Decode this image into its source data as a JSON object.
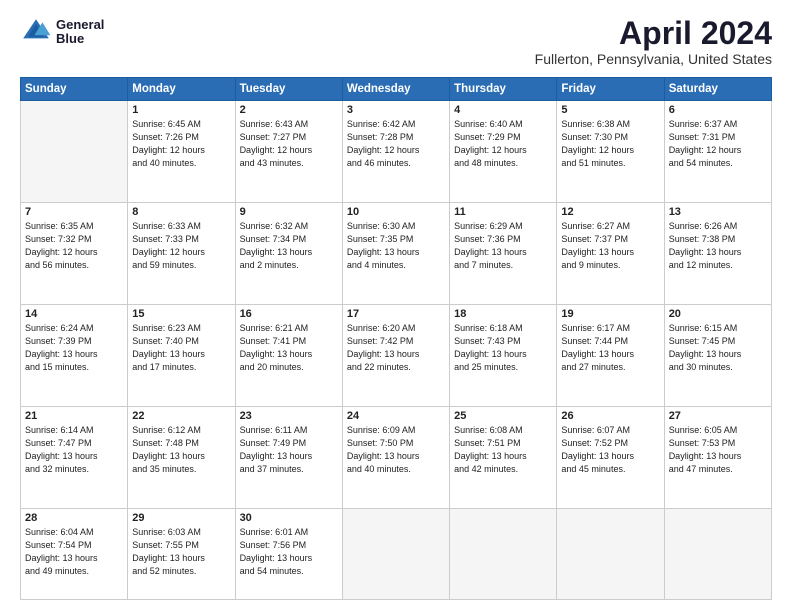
{
  "header": {
    "logo_line1": "General",
    "logo_line2": "Blue",
    "title": "April 2024",
    "subtitle": "Fullerton, Pennsylvania, United States"
  },
  "columns": [
    "Sunday",
    "Monday",
    "Tuesday",
    "Wednesday",
    "Thursday",
    "Friday",
    "Saturday"
  ],
  "weeks": [
    [
      {
        "day": "",
        "info": ""
      },
      {
        "day": "1",
        "info": "Sunrise: 6:45 AM\nSunset: 7:26 PM\nDaylight: 12 hours\nand 40 minutes."
      },
      {
        "day": "2",
        "info": "Sunrise: 6:43 AM\nSunset: 7:27 PM\nDaylight: 12 hours\nand 43 minutes."
      },
      {
        "day": "3",
        "info": "Sunrise: 6:42 AM\nSunset: 7:28 PM\nDaylight: 12 hours\nand 46 minutes."
      },
      {
        "day": "4",
        "info": "Sunrise: 6:40 AM\nSunset: 7:29 PM\nDaylight: 12 hours\nand 48 minutes."
      },
      {
        "day": "5",
        "info": "Sunrise: 6:38 AM\nSunset: 7:30 PM\nDaylight: 12 hours\nand 51 minutes."
      },
      {
        "day": "6",
        "info": "Sunrise: 6:37 AM\nSunset: 7:31 PM\nDaylight: 12 hours\nand 54 minutes."
      }
    ],
    [
      {
        "day": "7",
        "info": "Sunrise: 6:35 AM\nSunset: 7:32 PM\nDaylight: 12 hours\nand 56 minutes."
      },
      {
        "day": "8",
        "info": "Sunrise: 6:33 AM\nSunset: 7:33 PM\nDaylight: 12 hours\nand 59 minutes."
      },
      {
        "day": "9",
        "info": "Sunrise: 6:32 AM\nSunset: 7:34 PM\nDaylight: 13 hours\nand 2 minutes."
      },
      {
        "day": "10",
        "info": "Sunrise: 6:30 AM\nSunset: 7:35 PM\nDaylight: 13 hours\nand 4 minutes."
      },
      {
        "day": "11",
        "info": "Sunrise: 6:29 AM\nSunset: 7:36 PM\nDaylight: 13 hours\nand 7 minutes."
      },
      {
        "day": "12",
        "info": "Sunrise: 6:27 AM\nSunset: 7:37 PM\nDaylight: 13 hours\nand 9 minutes."
      },
      {
        "day": "13",
        "info": "Sunrise: 6:26 AM\nSunset: 7:38 PM\nDaylight: 13 hours\nand 12 minutes."
      }
    ],
    [
      {
        "day": "14",
        "info": "Sunrise: 6:24 AM\nSunset: 7:39 PM\nDaylight: 13 hours\nand 15 minutes."
      },
      {
        "day": "15",
        "info": "Sunrise: 6:23 AM\nSunset: 7:40 PM\nDaylight: 13 hours\nand 17 minutes."
      },
      {
        "day": "16",
        "info": "Sunrise: 6:21 AM\nSunset: 7:41 PM\nDaylight: 13 hours\nand 20 minutes."
      },
      {
        "day": "17",
        "info": "Sunrise: 6:20 AM\nSunset: 7:42 PM\nDaylight: 13 hours\nand 22 minutes."
      },
      {
        "day": "18",
        "info": "Sunrise: 6:18 AM\nSunset: 7:43 PM\nDaylight: 13 hours\nand 25 minutes."
      },
      {
        "day": "19",
        "info": "Sunrise: 6:17 AM\nSunset: 7:44 PM\nDaylight: 13 hours\nand 27 minutes."
      },
      {
        "day": "20",
        "info": "Sunrise: 6:15 AM\nSunset: 7:45 PM\nDaylight: 13 hours\nand 30 minutes."
      }
    ],
    [
      {
        "day": "21",
        "info": "Sunrise: 6:14 AM\nSunset: 7:47 PM\nDaylight: 13 hours\nand 32 minutes."
      },
      {
        "day": "22",
        "info": "Sunrise: 6:12 AM\nSunset: 7:48 PM\nDaylight: 13 hours\nand 35 minutes."
      },
      {
        "day": "23",
        "info": "Sunrise: 6:11 AM\nSunset: 7:49 PM\nDaylight: 13 hours\nand 37 minutes."
      },
      {
        "day": "24",
        "info": "Sunrise: 6:09 AM\nSunset: 7:50 PM\nDaylight: 13 hours\nand 40 minutes."
      },
      {
        "day": "25",
        "info": "Sunrise: 6:08 AM\nSunset: 7:51 PM\nDaylight: 13 hours\nand 42 minutes."
      },
      {
        "day": "26",
        "info": "Sunrise: 6:07 AM\nSunset: 7:52 PM\nDaylight: 13 hours\nand 45 minutes."
      },
      {
        "day": "27",
        "info": "Sunrise: 6:05 AM\nSunset: 7:53 PM\nDaylight: 13 hours\nand 47 minutes."
      }
    ],
    [
      {
        "day": "28",
        "info": "Sunrise: 6:04 AM\nSunset: 7:54 PM\nDaylight: 13 hours\nand 49 minutes."
      },
      {
        "day": "29",
        "info": "Sunrise: 6:03 AM\nSunset: 7:55 PM\nDaylight: 13 hours\nand 52 minutes."
      },
      {
        "day": "30",
        "info": "Sunrise: 6:01 AM\nSunset: 7:56 PM\nDaylight: 13 hours\nand 54 minutes."
      },
      {
        "day": "",
        "info": ""
      },
      {
        "day": "",
        "info": ""
      },
      {
        "day": "",
        "info": ""
      },
      {
        "day": "",
        "info": ""
      }
    ]
  ]
}
